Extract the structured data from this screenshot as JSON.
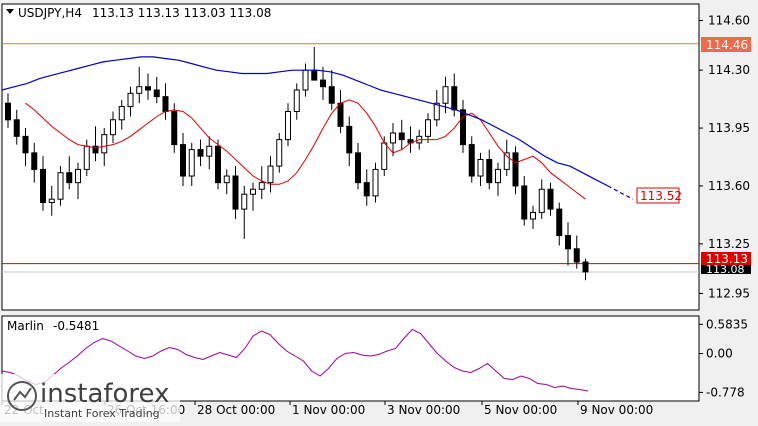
{
  "header": {
    "symbol": "USDJPY,H4",
    "ohlc": "113.13 113.13 113.03 113.08"
  },
  "price_axis": {
    "ticks": [
      "114.60",
      "114.30",
      "113.95",
      "113.60",
      "113.25",
      "112.95"
    ],
    "labels": {
      "level": "114.46",
      "ma": "113.52",
      "current": "113.13",
      "bid": "113.08"
    }
  },
  "indicator": {
    "name": "Marlin",
    "value": "-0.5481",
    "ticks": [
      "0.5835",
      "0.00",
      "-0.778"
    ]
  },
  "time_axis": [
    "22 Oct",
    "26 Oct 16:00",
    "28 Oct 00:00",
    "1 Nov 00:00",
    "3 Nov 00:00",
    "5 Nov 00:00",
    "9 Nov 00:00"
  ],
  "watermark": {
    "brand": "instaforex",
    "tagline": "Instant Forex Trading"
  },
  "colors": {
    "background": "#ffffff",
    "ma_slow": "#0000c8",
    "ma_fast": "#dc0000",
    "level_line": "#e87050",
    "current_line": "#dc0000",
    "oscillator": "#9b009b",
    "candles": "#000000"
  },
  "chart_data": [
    {
      "type": "candlestick",
      "title": "USDJPY,H4",
      "ylim": [
        112.85,
        114.7
      ],
      "horizontal_levels": [
        114.46,
        113.13
      ],
      "candles": [
        [
          114.1,
          114.16,
          113.95,
          114.0
        ],
        [
          114.0,
          114.06,
          113.85,
          113.9
        ],
        [
          113.9,
          113.95,
          113.72,
          113.8
        ],
        [
          113.8,
          113.86,
          113.62,
          113.7
        ],
        [
          113.7,
          113.78,
          113.45,
          113.5
        ],
        [
          113.5,
          113.6,
          113.42,
          113.52
        ],
        [
          113.52,
          113.72,
          113.48,
          113.68
        ],
        [
          113.68,
          113.78,
          113.58,
          113.62
        ],
        [
          113.62,
          113.74,
          113.52,
          113.7
        ],
        [
          113.7,
          113.88,
          113.66,
          113.84
        ],
        [
          113.84,
          113.96,
          113.75,
          113.8
        ],
        [
          113.8,
          113.95,
          113.72,
          113.91
        ],
        [
          113.91,
          114.05,
          113.86,
          114.0
        ],
        [
          114.0,
          114.12,
          113.94,
          114.08
        ],
        [
          114.08,
          114.2,
          114.02,
          114.16
        ],
        [
          114.16,
          114.32,
          114.1,
          114.2
        ],
        [
          114.2,
          114.28,
          114.12,
          114.18
        ],
        [
          114.18,
          114.26,
          114.1,
          114.14
        ],
        [
          114.14,
          114.22,
          114.0,
          114.05
        ],
        [
          114.05,
          114.1,
          113.8,
          113.85
        ],
        [
          113.85,
          113.92,
          113.6,
          113.66
        ],
        [
          113.66,
          113.86,
          113.6,
          113.82
        ],
        [
          113.82,
          113.88,
          113.72,
          113.78
        ],
        [
          113.78,
          113.9,
          113.7,
          113.84
        ],
        [
          113.84,
          113.88,
          113.58,
          113.62
        ],
        [
          113.62,
          113.7,
          113.55,
          113.66
        ],
        [
          113.66,
          113.72,
          113.4,
          113.46
        ],
        [
          113.46,
          113.6,
          113.28,
          113.55
        ],
        [
          113.55,
          113.62,
          113.45,
          113.58
        ],
        [
          113.58,
          113.72,
          113.52,
          113.62
        ],
        [
          113.62,
          113.78,
          113.56,
          113.72
        ],
        [
          113.72,
          113.92,
          113.68,
          113.88
        ],
        [
          113.88,
          114.1,
          113.84,
          114.05
        ],
        [
          114.05,
          114.22,
          114.0,
          114.18
        ],
        [
          114.18,
          114.34,
          114.14,
          114.3
        ],
        [
          114.3,
          114.44,
          114.24,
          114.24
        ],
        [
          114.24,
          114.32,
          114.12,
          114.2
        ],
        [
          114.2,
          114.3,
          114.06,
          114.1
        ],
        [
          114.1,
          114.18,
          113.92,
          113.96
        ],
        [
          113.96,
          114.02,
          113.72,
          113.8
        ],
        [
          113.8,
          113.86,
          113.58,
          113.62
        ],
        [
          113.62,
          113.7,
          113.48,
          113.54
        ],
        [
          113.54,
          113.74,
          113.5,
          113.7
        ],
        [
          113.7,
          113.9,
          113.66,
          113.86
        ],
        [
          113.86,
          113.98,
          113.78,
          113.92
        ],
        [
          113.92,
          114.0,
          113.82,
          113.88
        ],
        [
          113.88,
          113.96,
          113.8,
          113.86
        ],
        [
          113.86,
          113.94,
          113.82,
          113.9
        ],
        [
          113.9,
          114.04,
          113.86,
          114.0
        ],
        [
          114.0,
          114.18,
          113.96,
          114.1
        ],
        [
          114.1,
          114.26,
          114.04,
          114.2
        ],
        [
          114.2,
          114.28,
          114.02,
          114.06
        ],
        [
          114.06,
          114.12,
          113.8,
          113.85
        ],
        [
          113.85,
          113.9,
          113.62,
          113.66
        ],
        [
          113.66,
          113.8,
          113.6,
          113.76
        ],
        [
          113.76,
          113.82,
          113.58,
          113.62
        ],
        [
          113.62,
          113.74,
          113.54,
          113.7
        ],
        [
          113.7,
          113.88,
          113.66,
          113.8
        ],
        [
          113.8,
          113.84,
          113.55,
          113.6
        ],
        [
          113.6,
          113.66,
          113.36,
          113.4
        ],
        [
          113.4,
          113.48,
          113.34,
          113.44
        ],
        [
          113.44,
          113.64,
          113.4,
          113.58
        ],
        [
          113.58,
          113.62,
          113.42,
          113.46
        ],
        [
          113.46,
          113.5,
          113.24,
          113.3
        ],
        [
          113.3,
          113.38,
          113.12,
          113.22
        ],
        [
          113.22,
          113.3,
          113.1,
          113.14
        ],
        [
          113.14,
          113.16,
          113.03,
          113.08
        ]
      ],
      "series": [
        {
          "values": [
            114.1,
            114.06,
            114.01,
            113.96,
            113.92,
            113.88,
            113.85,
            113.84,
            113.83,
            113.84,
            113.85,
            113.87,
            113.9,
            113.94,
            113.98,
            114.02,
            114.05,
            114.06,
            114.05,
            114.01,
            113.95,
            113.89,
            113.85,
            113.81,
            113.76,
            113.71,
            113.66,
            113.63,
            113.61,
            113.61,
            113.63,
            113.68,
            113.76,
            113.85,
            113.95,
            114.04,
            114.1,
            114.12,
            114.1,
            114.04,
            113.96,
            113.86,
            113.8,
            113.82,
            113.86,
            113.88,
            113.88,
            113.88,
            113.9,
            113.95,
            114.02,
            114.04,
            114.0,
            113.92,
            113.84,
            113.78,
            113.74,
            113.76,
            113.78,
            113.74,
            113.68,
            113.64,
            113.6,
            113.56,
            113.52
          ]
        },
        {
          "values": [
            114.18,
            114.2,
            114.22,
            114.25,
            114.27,
            114.29,
            114.31,
            114.33,
            114.35,
            114.36,
            114.37,
            114.38,
            114.38,
            114.37,
            114.36,
            114.34,
            114.32,
            114.3,
            114.29,
            114.28,
            114.28,
            114.28,
            114.29,
            114.3,
            114.3,
            114.3,
            114.29,
            114.27,
            114.24,
            114.21,
            114.18,
            114.16,
            114.14,
            114.12,
            114.1,
            114.08,
            114.06,
            114.03,
            114.0,
            113.96,
            113.92,
            113.88,
            113.83,
            113.78,
            113.74,
            113.72,
            113.68,
            113.64,
            113.6,
            113.56,
            113.52
          ],
          "dashed_from": 48
        }
      ]
    },
    {
      "type": "line",
      "title": "Marlin -0.5481",
      "ylim": [
        -0.95,
        0.75
      ],
      "y_ticks": [
        0.5835,
        0.0,
        -0.778
      ],
      "series": [
        {
          "values": [
            -0.35,
            -0.38,
            -0.45,
            -0.55,
            -0.62,
            -0.58,
            -0.45,
            -0.3,
            -0.18,
            -0.05,
            0.1,
            0.22,
            0.3,
            0.25,
            0.15,
            0.05,
            -0.05,
            -0.1,
            -0.05,
            0.05,
            0.12,
            0.08,
            -0.02,
            -0.08,
            -0.12,
            -0.05,
            0.02,
            -0.03,
            -0.08,
            0.1,
            0.35,
            0.45,
            0.38,
            0.2,
            0.05,
            -0.05,
            -0.15,
            -0.35,
            -0.45,
            -0.3,
            -0.1,
            0.0,
            0.02,
            -0.03,
            -0.05,
            -0.02,
            0.05,
            0.1,
            0.3,
            0.48,
            0.4,
            0.2,
            0.0,
            -0.15,
            -0.28,
            -0.35,
            -0.38,
            -0.3,
            -0.2,
            -0.35,
            -0.5,
            -0.52,
            -0.45,
            -0.5,
            -0.6,
            -0.62,
            -0.68,
            -0.65,
            -0.7,
            -0.72,
            -0.75
          ]
        }
      ]
    }
  ]
}
